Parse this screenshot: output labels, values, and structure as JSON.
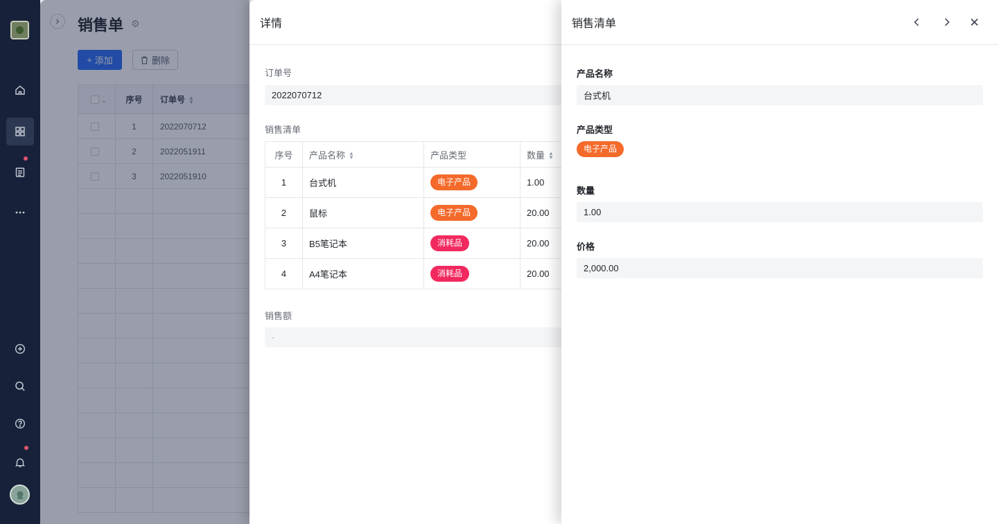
{
  "page": {
    "title": "销售单",
    "add_label": "添加",
    "delete_label": "删除",
    "table": {
      "headers": [
        "序号",
        "订单号"
      ],
      "rows": [
        {
          "no": "1",
          "order": "2022070712"
        },
        {
          "no": "2",
          "order": "2022051911"
        },
        {
          "no": "3",
          "order": "2022051910"
        }
      ]
    }
  },
  "detail": {
    "title": "详情",
    "order_label": "订单号",
    "order_value": "2022070712",
    "list_label": "销售清单",
    "list_headers": [
      "序号",
      "产品名称",
      "产品类型",
      "数量"
    ],
    "list_rows": [
      {
        "no": "1",
        "name": "台式机",
        "type": "电子产品",
        "qty": "1.00"
      },
      {
        "no": "2",
        "name": "鼠标",
        "type": "电子产品",
        "qty": "20.00"
      },
      {
        "no": "3",
        "name": "B5笔记本",
        "type": "消耗品",
        "qty": "20.00"
      },
      {
        "no": "4",
        "name": "A4笔记本",
        "type": "消耗品",
        "qty": "20.00"
      }
    ],
    "amount_label": "销售额",
    "amount_value": "-"
  },
  "record": {
    "title": "销售清单",
    "name_label": "产品名称",
    "name_value": "台式机",
    "type_label": "产品类型",
    "type_value": "电子产品",
    "qty_label": "数量",
    "qty_value": "1.00",
    "price_label": "价格",
    "price_value": "2,000.00"
  },
  "colors": {
    "accent": "#2468f2",
    "tag_electronic": "#f46a2b",
    "tag_consumable": "#f2295f",
    "sidebar": "#17223a"
  }
}
